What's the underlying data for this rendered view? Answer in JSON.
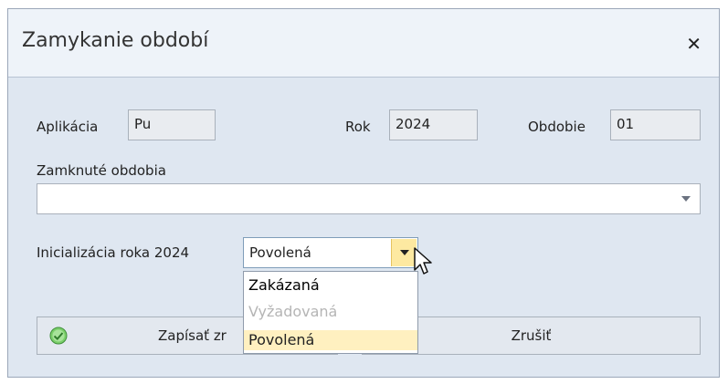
{
  "dialog": {
    "title": "Zamykanie období",
    "close_icon": "close-icon"
  },
  "form": {
    "app_label": "Aplikácia",
    "app_value": "Pu",
    "year_label": "Rok",
    "year_value": "2024",
    "period_label": "Obdobie",
    "period_value": "01",
    "closed_periods_label": "Zamknuté obdobia",
    "closed_periods_value": "",
    "init_label": "Inicializácia roka 2024",
    "init_value": "Povolená"
  },
  "dropdown": {
    "options": [
      {
        "label": "Zakázaná",
        "state": "enabled"
      },
      {
        "label": "Vyžadovaná",
        "state": "disabled"
      },
      {
        "label": "Povolená",
        "state": "selected"
      }
    ]
  },
  "buttons": {
    "save_label": "Zapísať zr",
    "cancel_label": "Zrušiť",
    "save_icon": "check-circle-icon"
  },
  "colors": {
    "dialog_bg": "#dfe7f1",
    "select_button": "#fde9a1",
    "selected_option": "#fff0c0",
    "check_icon": "#5cb85c"
  }
}
